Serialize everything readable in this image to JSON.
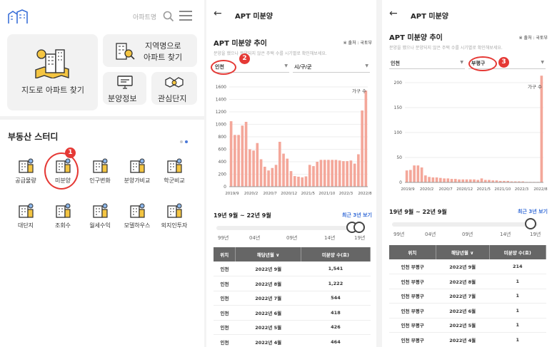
{
  "home": {
    "search_placeholder": "아파트명",
    "card_map": "지도로 아파트 찾기",
    "card_region_line1": "지역명으로",
    "card_region_line2": "아파트 찾기",
    "card_info": "분양정보",
    "card_interest": "관심단지",
    "study_title": "부동산 스터디",
    "tiles": [
      "공급물량",
      "미분양",
      "인구변화",
      "분양가비교",
      "학군비교",
      "대단지",
      "조회수",
      "월세수익",
      "모델하우스",
      "외지인투자"
    ],
    "step1": "1"
  },
  "detail": {
    "back_icon": "←",
    "title": "APT 미분양",
    "chart_title": "APT 미분양 추이",
    "source": "※ 출처 : 국토부",
    "subtitle": "분양을 했으나 분양되지 않은 주택 수를 시기별로 확인해보세요.",
    "legend": "가구 수",
    "range": "19년 9월 ~ 22년 9월",
    "recent": "최근 3년 보기",
    "years": [
      "99년",
      "04년",
      "09년",
      "14년",
      "19년"
    ],
    "cols": [
      "위치",
      "해당년월 ∨",
      "미분양 수(호)"
    ]
  },
  "panel2": {
    "region": "인천",
    "district": "시/구/군",
    "step": "2",
    "rows": [
      [
        "인천",
        "2022년 9월",
        "1,541"
      ],
      [
        "인천",
        "2022년 8월",
        "1,222"
      ],
      [
        "인천",
        "2022년 7월",
        "544"
      ],
      [
        "인천",
        "2022년 6월",
        "418"
      ],
      [
        "인천",
        "2022년 5월",
        "426"
      ],
      [
        "인천",
        "2022년 4월",
        "464"
      ]
    ]
  },
  "panel3": {
    "region": "인천",
    "district": "부평구",
    "step": "3",
    "rows": [
      [
        "인천 부평구",
        "2022년 9월",
        "214"
      ],
      [
        "인천 부평구",
        "2022년 8월",
        "1"
      ],
      [
        "인천 부평구",
        "2022년 7월",
        "1"
      ],
      [
        "인천 부평구",
        "2022년 6월",
        "1"
      ],
      [
        "인천 부평구",
        "2022년 5월",
        "1"
      ],
      [
        "인천 부평구",
        "2022년 4월",
        "1"
      ]
    ]
  },
  "chart_data": [
    {
      "type": "bar",
      "title": "APT 미분양 추이",
      "legend": "가구 수",
      "ylim": [
        0,
        1600
      ],
      "yticks": [
        0,
        200,
        400,
        600,
        800,
        1000,
        1200,
        1400,
        1600
      ],
      "xticks": [
        "2019/9",
        "2020/2",
        "2020/7",
        "2020/12",
        "2021/5",
        "2021/10",
        "2022/3",
        "2022/8"
      ],
      "values": [
        1050,
        830,
        830,
        980,
        1040,
        600,
        580,
        700,
        440,
        320,
        260,
        300,
        350,
        720,
        530,
        450,
        250,
        170,
        160,
        150,
        165,
        350,
        330,
        400,
        430,
        430,
        430,
        430,
        430,
        420,
        410,
        410,
        420,
        370,
        520,
        1222,
        1541
      ],
      "color": "#f4a79a"
    },
    {
      "type": "bar",
      "title": "APT 미분양 추이",
      "legend": "가구 수",
      "ylim": [
        0,
        200
      ],
      "yticks": [
        0,
        50,
        100,
        150,
        200
      ],
      "xticks": [
        "2019/9",
        "2020/2",
        "2020/7",
        "2020/12",
        "2021/5",
        "2021/10",
        "2022/3",
        "2022/8"
      ],
      "values": [
        24,
        25,
        34,
        34,
        30,
        14,
        11,
        10,
        10,
        9,
        8,
        8,
        7,
        7,
        6,
        6,
        6,
        6,
        6,
        5,
        8,
        5,
        5,
        4,
        4,
        3,
        3,
        3,
        2,
        2,
        2,
        2,
        1,
        1,
        1,
        1,
        214
      ],
      "color": "#f4a79a"
    }
  ],
  "colors": {
    "accent": "#3a6fd8",
    "bar": "#f4a79a",
    "badge": "#e53935"
  }
}
